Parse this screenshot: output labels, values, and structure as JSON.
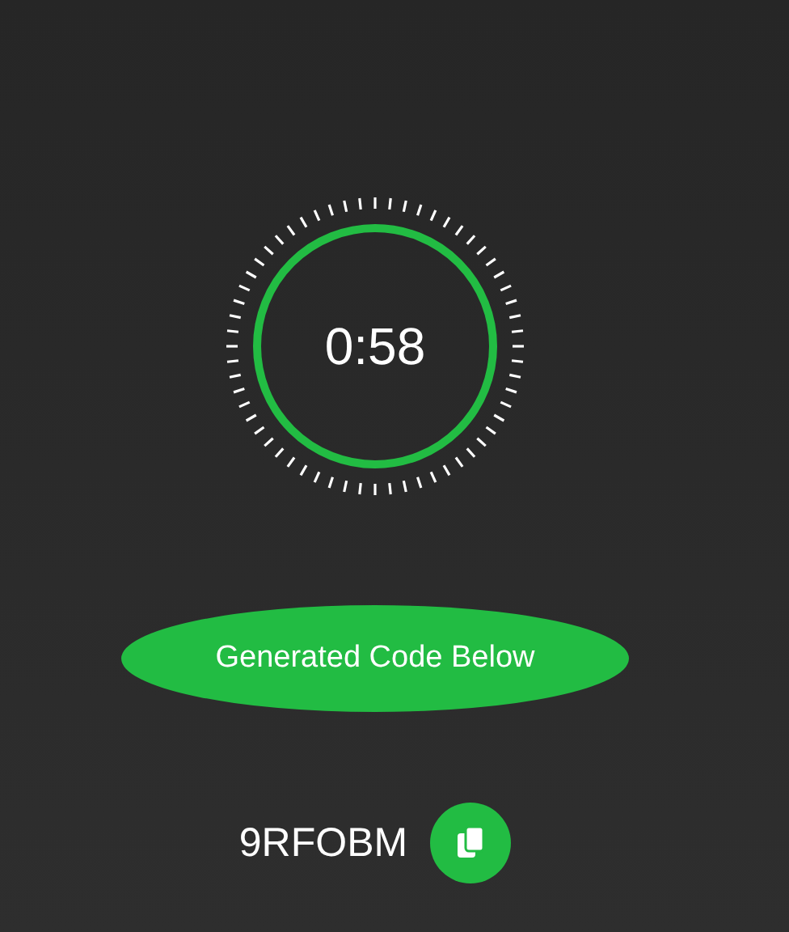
{
  "timer": {
    "time": "0:58"
  },
  "generate_button": {
    "label": "Generated Code Below"
  },
  "code": {
    "value": "9RFOBM"
  }
}
